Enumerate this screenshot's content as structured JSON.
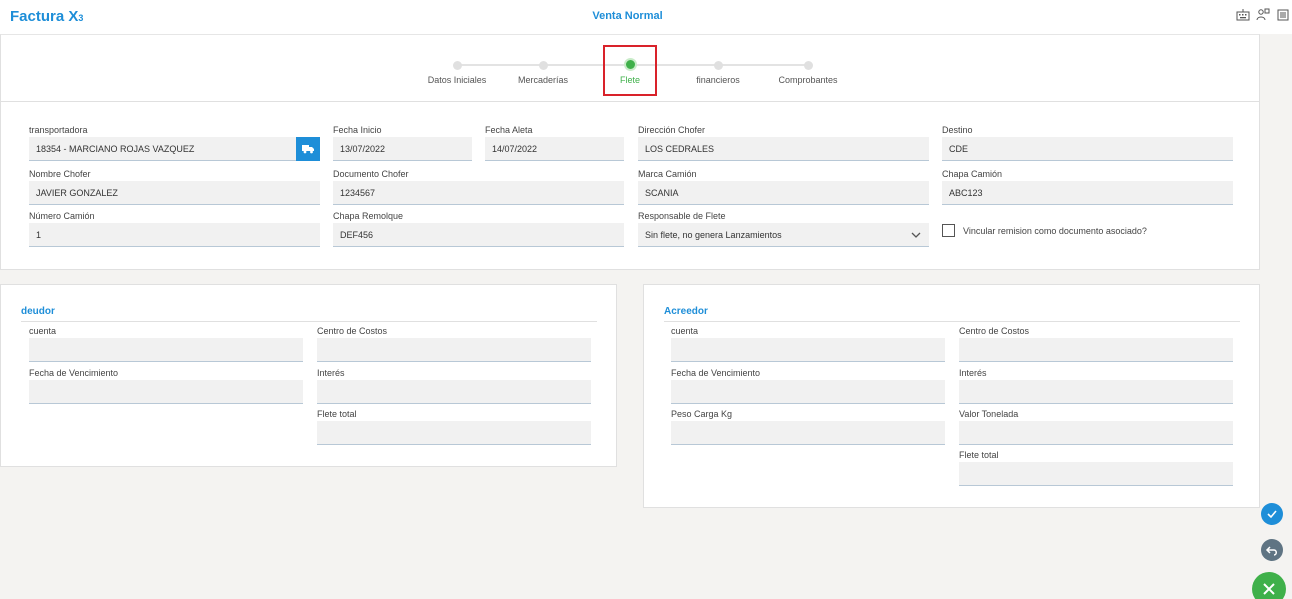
{
  "header": {
    "logo_main": "Factura X",
    "logo_sub": "3",
    "title": "Venta Normal",
    "icons": [
      "keyboard-icon",
      "users-icon",
      "document-icon"
    ]
  },
  "stepper": {
    "steps": [
      {
        "label": "Datos Iniciales",
        "active": false
      },
      {
        "label": "Mercaderías",
        "active": false
      },
      {
        "label": "Flete",
        "active": true
      },
      {
        "label": "financieros",
        "active": false
      },
      {
        "label": "Comprobantes",
        "active": false
      }
    ]
  },
  "form": {
    "transportadora": {
      "label": "transportadora",
      "value": "18354 - MARCIANO ROJAS VAZQUEZ"
    },
    "fecha_inicio": {
      "label": "Fecha Inicio",
      "value": "13/07/2022"
    },
    "fecha_aleta": {
      "label": "Fecha Aleta",
      "value": "14/07/2022"
    },
    "direccion_chofer": {
      "label": "Dirección Chofer",
      "value": "LOS CEDRALES"
    },
    "destino": {
      "label": "Destino",
      "value": "CDE"
    },
    "nombre_chofer": {
      "label": "Nombre Chofer",
      "value": "JAVIER GONZALEZ"
    },
    "documento_chofer": {
      "label": "Documento Chofer",
      "value": "1234567"
    },
    "marca_camion": {
      "label": "Marca Camión",
      "value": "SCANIA"
    },
    "chapa_camion": {
      "label": "Chapa Camión",
      "value": "ABC123"
    },
    "numero_camion": {
      "label": "Número Camión",
      "value": "1"
    },
    "chapa_remolque": {
      "label": "Chapa Remolque",
      "value": "DEF456"
    },
    "responsable_flete": {
      "label": "Responsable de Flete",
      "value": "Sin flete, no genera Lanzamientos"
    },
    "vincular": {
      "label": "Vincular remision como documento asociado?",
      "checked": false
    }
  },
  "deudor": {
    "title": "deudor",
    "cuenta": {
      "label": "cuenta",
      "value": ""
    },
    "centro_costos": {
      "label": "Centro de Costos",
      "value": ""
    },
    "fecha_vencimiento": {
      "label": "Fecha de Vencimiento",
      "value": ""
    },
    "interes": {
      "label": "Interés",
      "value": ""
    },
    "flete_total": {
      "label": "Flete total",
      "value": ""
    }
  },
  "acreedor": {
    "title": "Acreedor",
    "cuenta": {
      "label": "cuenta",
      "value": ""
    },
    "centro_costos": {
      "label": "Centro de Costos",
      "value": ""
    },
    "fecha_vencimiento": {
      "label": "Fecha de Vencimiento",
      "value": ""
    },
    "interes": {
      "label": "Interés",
      "value": ""
    },
    "peso_carga": {
      "label": "Peso Carga Kg",
      "value": ""
    },
    "valor_tonelada": {
      "label": "Valor Tonelada",
      "value": ""
    },
    "flete_total": {
      "label": "Flete total",
      "value": ""
    }
  },
  "actions": {
    "confirm_icon": "check-icon",
    "back_icon": "undo-icon",
    "close_icon": "close-icon",
    "colors": {
      "confirm": "#1e8ed8",
      "back": "#5f7483",
      "close": "#3fb04a"
    }
  }
}
